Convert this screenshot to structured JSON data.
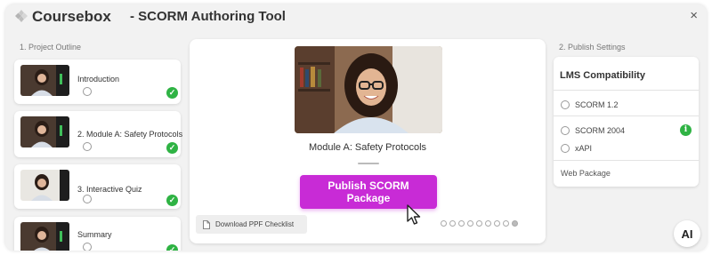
{
  "header": {
    "brand": "Coursebox",
    "tool_title": "- SCORM Authoring Tool",
    "close_glyph": "×"
  },
  "outline": {
    "label": "1. Project Outline",
    "steps": [
      {
        "label": "Introduction",
        "completed": true
      },
      {
        "label": "2. Module A: Safety Protocols",
        "completed": true
      },
      {
        "label": "3. Interactive Quiz",
        "completed": true
      },
      {
        "label": "Summary",
        "completed": true
      }
    ]
  },
  "main": {
    "module_title": "Module A: Safety Protocols",
    "publish_label": "Publish SCORM Package",
    "download_label": "Download PPF Checklist",
    "pagination": {
      "total": 9,
      "active_index": 8
    }
  },
  "publish_settings": {
    "label": "2. Publish Settings",
    "lms_title": "LMS Compatibility",
    "options": [
      {
        "label": "SCORM 1.2"
      },
      {
        "label": "SCORM 2004",
        "info": true
      },
      {
        "label": "xAPI"
      }
    ],
    "web_package": "Web Package"
  },
  "ai_badge": "AI",
  "colors": {
    "accent": "#c82bd6",
    "success": "#2fb344",
    "background": "#f2f2f2"
  },
  "icons": [
    "coursebox-logo-icon",
    "close-icon",
    "check-icon",
    "document-icon",
    "info-icon",
    "mouse-pointer-icon"
  ]
}
